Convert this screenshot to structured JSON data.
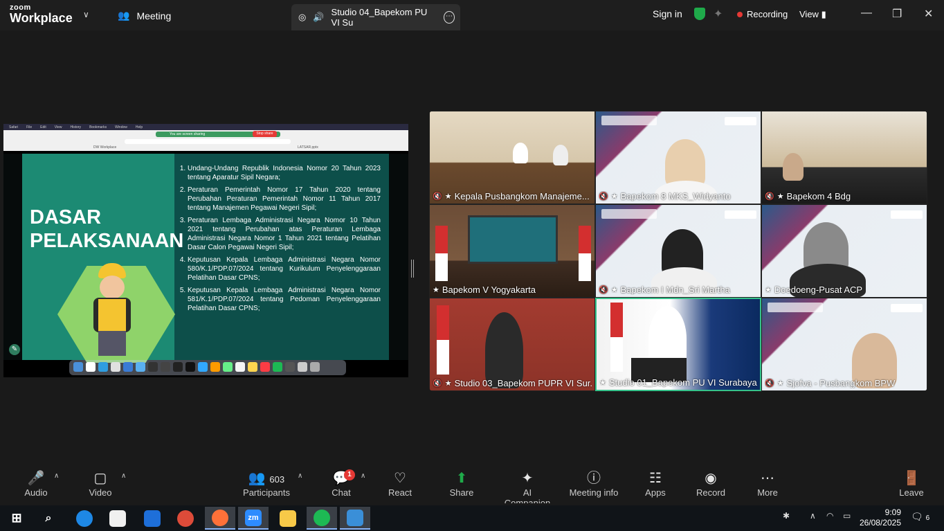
{
  "titlebar": {
    "brand_top": "zoom",
    "brand_bottom": "Workplace",
    "meeting_label": "Meeting",
    "tab_title": "Studio 04_Bapekom PU VI Su",
    "sign_in": "Sign in",
    "recording": "Recording",
    "view": "View"
  },
  "share": {
    "slide_title_line1": "DASAR",
    "slide_title_line2": "PELAKSANAAN",
    "items": [
      "Undang-Undang Republik Indonesia Nomor 20 Tahun 2023 tentang Aparatur Sipil Negara;",
      "Peraturan Pemerintah Nomor 17 Tahun 2020 tentang Perubahan Peraturan Pemerintah Nomor 11 Tahun 2017 tentang Manajemen Pegawai Negeri Sipil;",
      "Peraturan Lembaga Administrasi Negara Nomor 10 Tahun 2021 tentang Perubahan atas Peraturan Lembaga Administrasi Negara Nomor 1 Tahun 2021 tentang Pelatihan Dasar Calon Pegawai Negeri Sipil;",
      "Keputusan Kepala Lembaga Administrasi Negara Nomor 580/K.1/PDP.07/2024 tentang Kurikulum Penyelenggaraan Pelatihan Dasar CPNS;",
      "Keputusan Kepala Lembaga Administrasi Negara Nomor 581/K.1/PDP.07/2024 tentang Pedoman Penyelenggaraan Pelatihan Dasar CPNS;"
    ],
    "browser_sharing": "You are screen sharing",
    "browser_stop": "Stop share",
    "browser_tab1": "DW Workplace",
    "browser_tab2": "LATSAR.pptx"
  },
  "participants": [
    {
      "name": "Kepala Pusbangkom Manajeme...",
      "muted": true
    },
    {
      "name": "Bapekom 8 MKS_Widyanto",
      "muted": true
    },
    {
      "name": "Bapekom 4 Bdg",
      "muted": true
    },
    {
      "name": "Bapekom V Yogyakarta",
      "muted": false
    },
    {
      "name": "Bapekom I Mdn_Sri Martha",
      "muted": true
    },
    {
      "name": "Doedoeng-Pusat ACP",
      "muted": false
    },
    {
      "name": "Studio 03_Bapekom PUPR VI Sur...",
      "muted": true
    },
    {
      "name": "Studio 01_Bapekom PU VI Surabaya",
      "muted": false
    },
    {
      "name": "Sjofva  - Pusbangkom BPW",
      "muted": true
    }
  ],
  "toolbar": {
    "audio": "Audio",
    "video": "Video",
    "participants": "Participants",
    "participants_count": "603",
    "chat": "Chat",
    "chat_badge": "1",
    "react": "React",
    "share": "Share",
    "ai_companion": "AI Companion",
    "meeting_info": "Meeting info",
    "apps": "Apps",
    "record": "Record",
    "more": "More",
    "leave": "Leave"
  },
  "taskbar": {
    "time": "9:09",
    "date": "26/08/2025",
    "notifications": "6",
    "zoom_label": "zm"
  },
  "colors": {
    "accent_green": "#1faa4a",
    "record_red": "#e53935",
    "active_speaker": "#35c28a",
    "slide_teal": "#0d4f4a"
  }
}
